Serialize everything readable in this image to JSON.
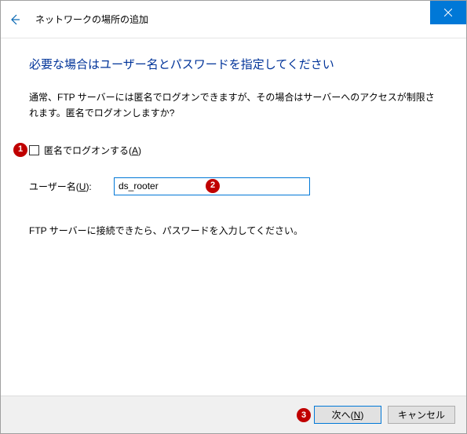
{
  "titlebar": {
    "title": "ネットワークの場所の追加"
  },
  "main": {
    "heading": "必要な場合はユーザー名とパスワードを指定してください",
    "description": "通常、FTP サーバーには匿名でログオンできますが、その場合はサーバーへのアクセスが制限されます。匿名でログオンしますか?",
    "anonymous_checkbox_label": "匿名でログオンする(",
    "anonymous_checkbox_accel": "A",
    "anonymous_checkbox_label_close": ")",
    "username_label": "ユーザー名(",
    "username_accel": "U",
    "username_label_close": "):",
    "username_value": "ds_rooter",
    "note": "FTP サーバーに接続できたら、パスワードを入力してください。"
  },
  "footer": {
    "next_label_pre": "次へ(",
    "next_accel": "N",
    "next_label_post": ")",
    "cancel_label": "キャンセル"
  },
  "annotations": {
    "a1": "1",
    "a2": "2",
    "a3": "3"
  }
}
